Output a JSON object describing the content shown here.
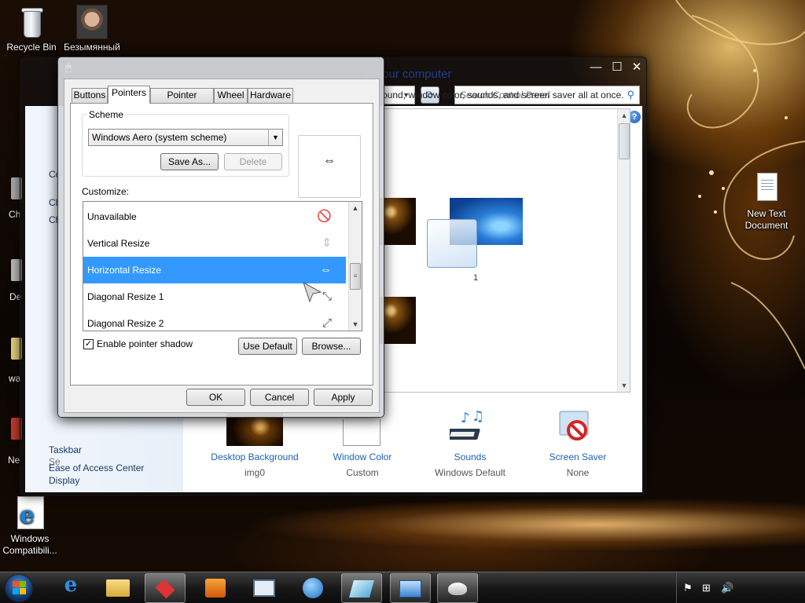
{
  "desktop": {
    "icons": [
      {
        "label": "Recycle Bin",
        "icon": "recycle-bin-icon"
      },
      {
        "label": "Безымянный",
        "icon": "photo-icon"
      },
      {
        "label": "New Text Document",
        "icon": "text-document-icon"
      },
      {
        "label": "Windows Compatibili...",
        "icon": "internet-explorer-icon"
      }
    ],
    "edge_labels": [
      "Ch",
      "De",
      "wa",
      "Ne"
    ]
  },
  "personalization": {
    "search_placeholder": "Search Control Panel",
    "heading": "n your computer",
    "subheading": "ound, window color, sounds, and screen saver all at once.",
    "sidebar_partial": [
      "Co",
      "Ch",
      "Ch"
    ],
    "see_also_partial": "Se",
    "sidebar_links": [
      "Display",
      "Taskbar",
      "Ease of Access Center"
    ],
    "theme_caption": "1",
    "bottom": [
      {
        "label": "Desktop Background",
        "value": "img0"
      },
      {
        "label": "Window Color",
        "value": "Custom"
      },
      {
        "label": "Sounds",
        "value": "Windows Default"
      },
      {
        "label": "Screen Saver",
        "value": "None"
      }
    ]
  },
  "mouse_dialog": {
    "tabs": [
      "Buttons",
      "Pointers",
      "Pointer Options",
      "Wheel",
      "Hardware"
    ],
    "active_tab": "Pointers",
    "scheme_label": "Scheme",
    "scheme_value": "Windows Aero (system scheme)",
    "save_as": "Save As...",
    "delete": "Delete",
    "preview_icon": "⇔",
    "customize_label": "Customize:",
    "pointers": [
      {
        "name": "Unavailable",
        "icon": "🚫"
      },
      {
        "name": "Vertical Resize",
        "icon": "⇕"
      },
      {
        "name": "Horizontal Resize",
        "icon": "⇔"
      },
      {
        "name": "Diagonal Resize 1",
        "icon": "⤡"
      },
      {
        "name": "Diagonal Resize 2",
        "icon": "⤢"
      }
    ],
    "selected_pointer": "Horizontal Resize",
    "shadow_label": "Enable pointer shadow",
    "shadow_checked": true,
    "use_default": "Use Default",
    "browse": "Browse...",
    "ok": "OK",
    "cancel": "Cancel",
    "apply": "Apply"
  },
  "taskbar": {
    "apps": [
      "internet-explorer-icon",
      "folder-icon",
      "app-red-icon",
      "media-player-icon",
      "remote-desktop-icon",
      "browser-icon",
      "glass-icon",
      "control-panel-icon",
      "mouse-icon"
    ]
  }
}
